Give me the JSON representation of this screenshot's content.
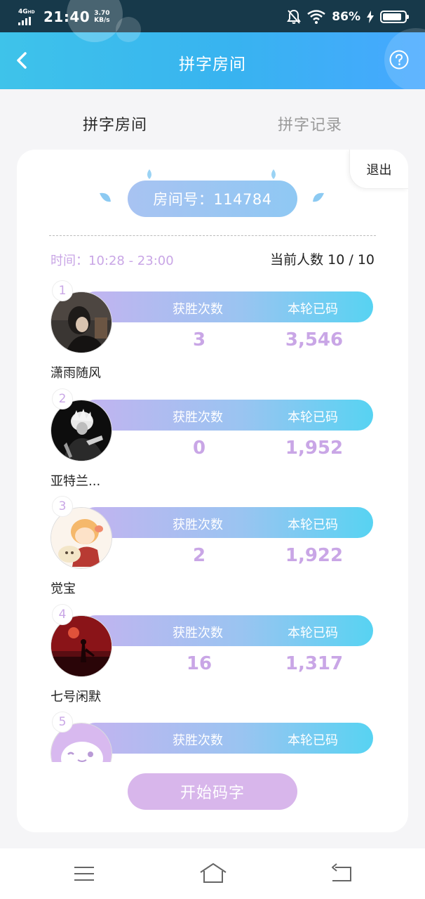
{
  "status_bar": {
    "network": "4G",
    "network_sup": "HD",
    "time": "21:40",
    "speed_value": "3.70",
    "speed_unit": "KB/s",
    "battery": "86%",
    "battery_level": 0.86
  },
  "header": {
    "title": "拼字房间"
  },
  "tabs": [
    {
      "label": "拼字房间",
      "active": true
    },
    {
      "label": "拼字记录",
      "active": false
    }
  ],
  "room": {
    "exit_label": "退出",
    "room_number_label": "房间号：114784",
    "time_label": "时间：10:28 - 23:00",
    "count_label": "当前人数 10 / 10"
  },
  "stat_headers": {
    "wins": "获胜次数",
    "chars": "本轮已码"
  },
  "players": [
    {
      "rank": "1",
      "name": "潇雨随风",
      "wins": "3",
      "chars": "3,546"
    },
    {
      "rank": "2",
      "name": "亚特兰...",
      "wins": "0",
      "chars": "1,952"
    },
    {
      "rank": "3",
      "name": "觉宝",
      "wins": "2",
      "chars": "1,922"
    },
    {
      "rank": "4",
      "name": "七号闲默",
      "wins": "16",
      "chars": "1,317"
    },
    {
      "rank": "5"
    }
  ],
  "start_button": "开始码字",
  "colors": {
    "header_start": "#3ec3ea",
    "header_end": "#46a8ff",
    "accent_purple": "#c9a6e6",
    "stat_bar_start": "#c4b3f0",
    "stat_bar_end": "#57d3f2",
    "start_button": "#d8b6eb"
  },
  "icons": {
    "back": "chevron-left-icon",
    "help": "question-circle-icon",
    "mute": "bell-off-icon",
    "wifi": "wifi-icon",
    "charging": "lightning-icon",
    "nav_menu": "menu-icon",
    "nav_home": "home-icon",
    "nav_back": "return-icon"
  }
}
